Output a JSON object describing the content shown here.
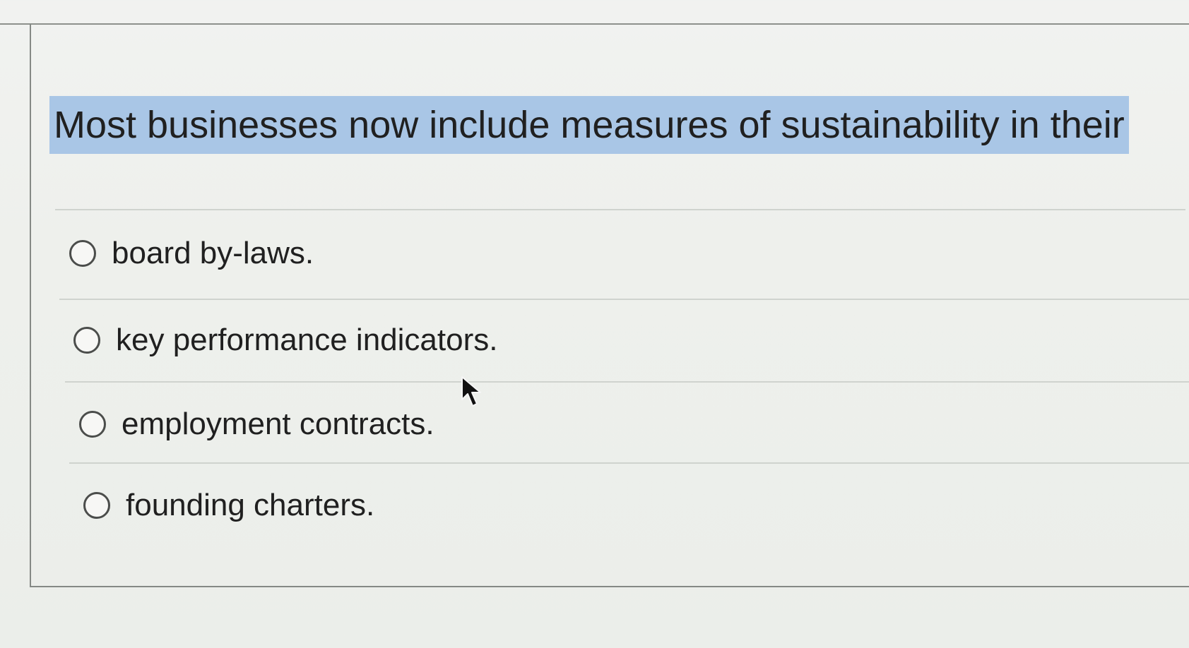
{
  "question": {
    "text": "Most businesses now include measures of sustainability in their"
  },
  "options": [
    {
      "label": "board by-laws.",
      "selected": false
    },
    {
      "label": "key performance indicators.",
      "selected": false
    },
    {
      "label": "employment contracts.",
      "selected": false
    },
    {
      "label": "founding charters.",
      "selected": false
    }
  ],
  "colors": {
    "highlight": "#a9c6e6",
    "text": "#202020",
    "background": "#eef0ec"
  },
  "icons": {
    "option_control": "radio-icon",
    "pointer": "cursor-arrow-icon"
  }
}
